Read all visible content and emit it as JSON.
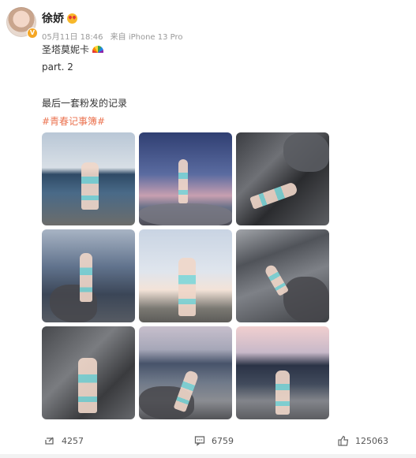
{
  "post": {
    "username": "徐娇",
    "username_emoji": "heart-eyes-emoji",
    "date": "05月11日 18:46",
    "source": "来自 iPhone 13 Pro",
    "line1": "圣塔莫妮卡",
    "line1_emoji": "rainbow-emoji",
    "line2": "part. 2",
    "line3": "最后一套粉发的记录",
    "hashtag": "#青春记事簿#"
  },
  "photos": [
    {
      "name": "photo-1"
    },
    {
      "name": "photo-2"
    },
    {
      "name": "photo-3"
    },
    {
      "name": "photo-4"
    },
    {
      "name": "photo-5"
    },
    {
      "name": "photo-6"
    },
    {
      "name": "photo-7"
    },
    {
      "name": "photo-8"
    },
    {
      "name": "photo-9"
    }
  ],
  "actions": {
    "repost_count": "4257",
    "comment_count": "6759",
    "like_count": "125063"
  },
  "colors": {
    "hashtag": "#eb7350",
    "meta": "#999999",
    "badge": "#f5a623"
  }
}
